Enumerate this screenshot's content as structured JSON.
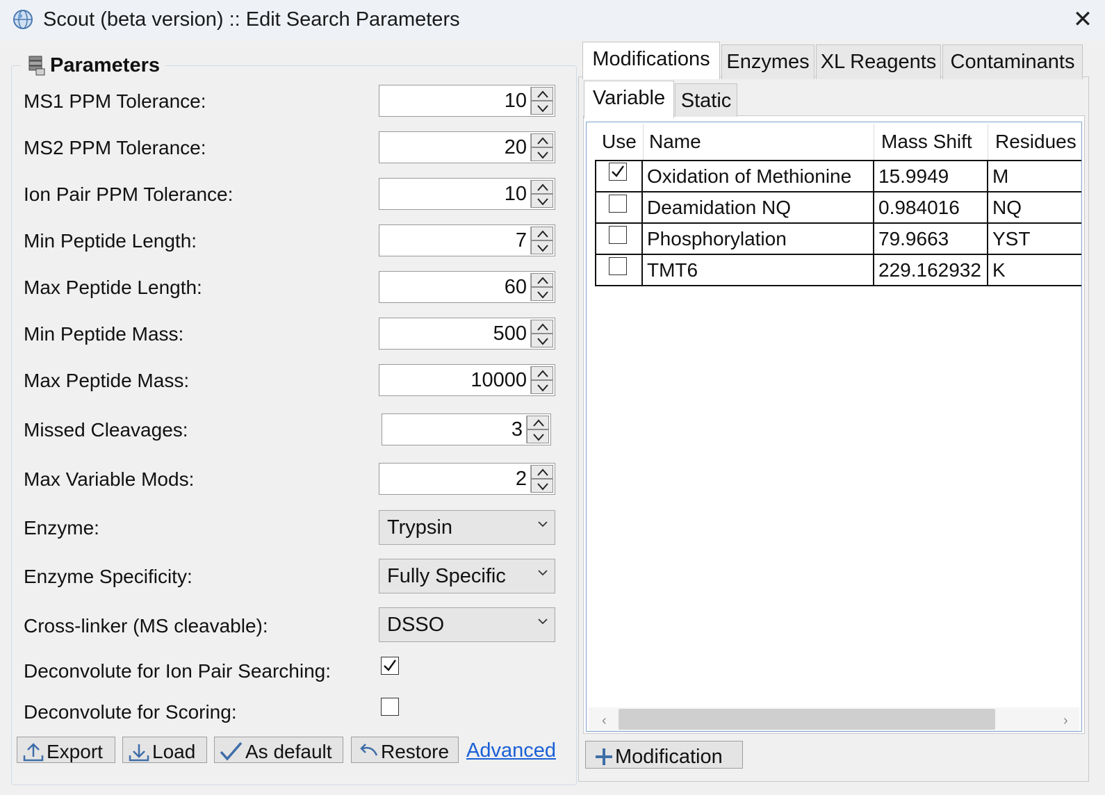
{
  "window": {
    "title": "Scout (beta version) :: Edit Search Parameters",
    "close_glyph": "✕",
    "icon": "globe-app-icon"
  },
  "parameters": {
    "group_title": "Parameters",
    "group_icon": "database-icon",
    "fields": [
      {
        "label": "MS1 PPM Tolerance:",
        "value": "10"
      },
      {
        "label": "MS2 PPM Tolerance:",
        "value": "20"
      },
      {
        "label": "Ion Pair PPM Tolerance:",
        "value": "10"
      },
      {
        "label": "Min Peptide Length:",
        "value": "7"
      },
      {
        "label": "Max Peptide Length:",
        "value": "60"
      },
      {
        "label": "Min Peptide Mass:",
        "value": "500"
      },
      {
        "label": "Max Peptide Mass:",
        "value": "10000"
      },
      {
        "label": "Missed Cleavages:",
        "value": "3"
      },
      {
        "label": "Max Variable Mods:",
        "value": "2"
      }
    ],
    "dropdowns": [
      {
        "label": "Enzyme:",
        "value": "Trypsin"
      },
      {
        "label": "Enzyme Specificity:",
        "value": "Fully Specific"
      },
      {
        "label": "Cross-linker (MS cleavable):",
        "value": "DSSO"
      }
    ],
    "checkboxes": [
      {
        "label": "Deconvolute for Ion Pair Searching:",
        "checked": true
      },
      {
        "label": "Deconvolute for Scoring:",
        "checked": false
      }
    ]
  },
  "actions": {
    "export": "Export",
    "load": "Load",
    "as_default": "As default",
    "restore": "Restore",
    "advanced": "Advanced"
  },
  "tabs": {
    "main": [
      "Modifications",
      "Enzymes",
      "XL Reagents",
      "Contaminants"
    ],
    "active_main": "Modifications",
    "sub": [
      "Variable",
      "Static"
    ],
    "active_sub": "Variable"
  },
  "modifications_table": {
    "columns": [
      "Use",
      "Name",
      "Mass Shift",
      "Residues"
    ],
    "rows": [
      {
        "use": true,
        "name": "Oxidation of Methionine",
        "mass_shift": "15.9949",
        "residues": "M"
      },
      {
        "use": false,
        "name": "Deamidation NQ",
        "mass_shift": "0.984016",
        "residues": "NQ"
      },
      {
        "use": false,
        "name": "Phosphorylation",
        "mass_shift": "79.9663",
        "residues": "YST"
      },
      {
        "use": false,
        "name": "TMT6",
        "mass_shift": "229.162932",
        "residues": "K"
      }
    ],
    "scroll_left": "‹",
    "scroll_right": "›"
  },
  "add_modification_label": "Modification",
  "colors": {
    "accent_border": "#7da2ce",
    "link": "#1a5fd6",
    "window_bg": "#f0f0f0"
  }
}
